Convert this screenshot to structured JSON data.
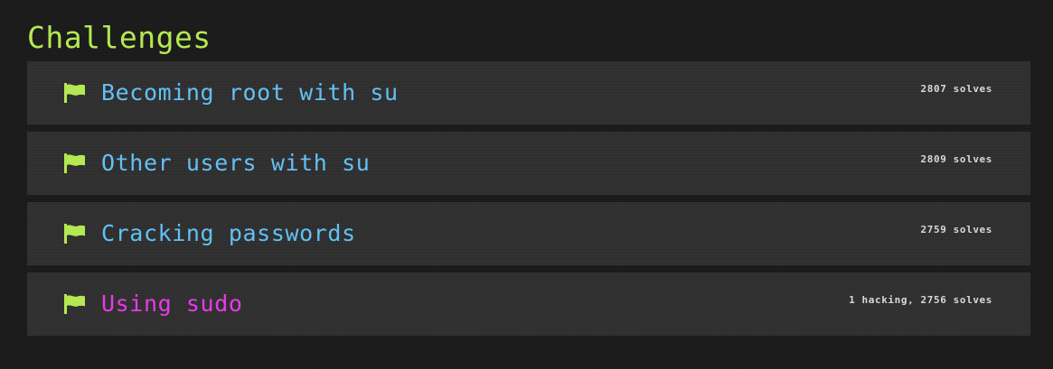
{
  "section": {
    "title": "Challenges"
  },
  "colors": {
    "accent": "#b5e853",
    "link": "#63c0f5",
    "active_link": "#e83ae8",
    "card": "#303030",
    "background": "#1b1b1b"
  },
  "challenges": [
    {
      "icon": "flag-icon",
      "name": "Becoming root with su",
      "solves": "2807 solves"
    },
    {
      "icon": "flag-icon",
      "name": "Other users with su",
      "solves": "2809 solves"
    },
    {
      "icon": "flag-icon",
      "name": "Cracking passwords",
      "solves": "2759 solves"
    },
    {
      "icon": "flag-icon",
      "name": "Using sudo",
      "solves": "1 hacking, 2756 solves"
    }
  ]
}
